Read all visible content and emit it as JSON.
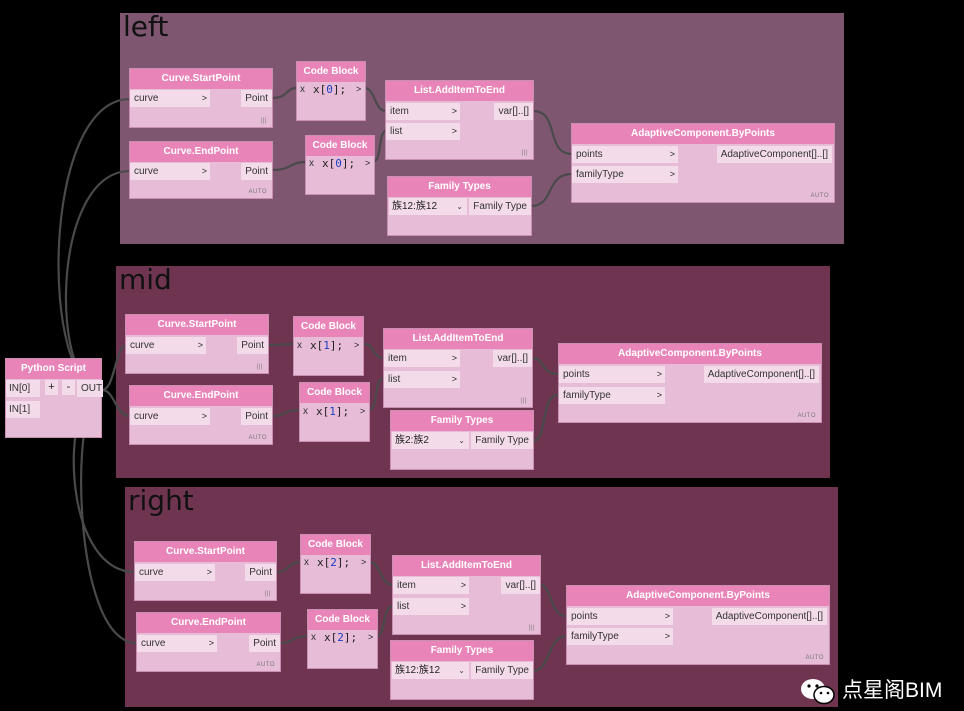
{
  "groups": [
    {
      "title": "left",
      "color": "#7e5670"
    },
    {
      "title": "mid",
      "color": "#6f3550"
    },
    {
      "title": "right",
      "color": "#6f3550"
    }
  ],
  "python": {
    "title": "Python Script",
    "in0": "IN[0]",
    "in1": "IN[1]",
    "plus": "+",
    "minus": "-",
    "out": "OUT"
  },
  "labels": {
    "curve_start": "Curve.StartPoint",
    "curve_end": "Curve.EndPoint",
    "curve": "curve",
    "point": "Point",
    "code_block": "Code Block",
    "x": "x",
    "list_add": "List.AddItemToEnd",
    "item": "item",
    "list": "list",
    "var": "var[]..[]",
    "family_types": "Family Types",
    "family_type": "Family Type",
    "adaptive": "AdaptiveComponent.ByPoints",
    "points": "points",
    "familyType": "familyType",
    "adaptive_out": "AdaptiveComponent[]..[]",
    "auto": "AUTO",
    "lacing": "|||",
    "arrow": ">"
  },
  "code": {
    "left_start": [
      "x[",
      "0",
      "];"
    ],
    "left_end": [
      "x[",
      "0",
      "];"
    ],
    "mid_start": [
      "x[",
      "1",
      "];"
    ],
    "mid_end": [
      "x[",
      "1",
      "];"
    ],
    "right_start": [
      "x[",
      "2",
      "];"
    ],
    "right_end": [
      "x[",
      "2",
      "];"
    ]
  },
  "families": {
    "left": "族12:族12",
    "mid": "族2:族2",
    "right": "族12:族12"
  },
  "watermark": "点星阁BIM",
  "colors": {
    "header": "#e884b8",
    "node": "#e7bcd6",
    "port": "#f3dbe9",
    "wire": "#4a4a4a"
  },
  "icons": {
    "chevron": "chevron-down-icon",
    "logo": "wechat-logo-icon"
  }
}
